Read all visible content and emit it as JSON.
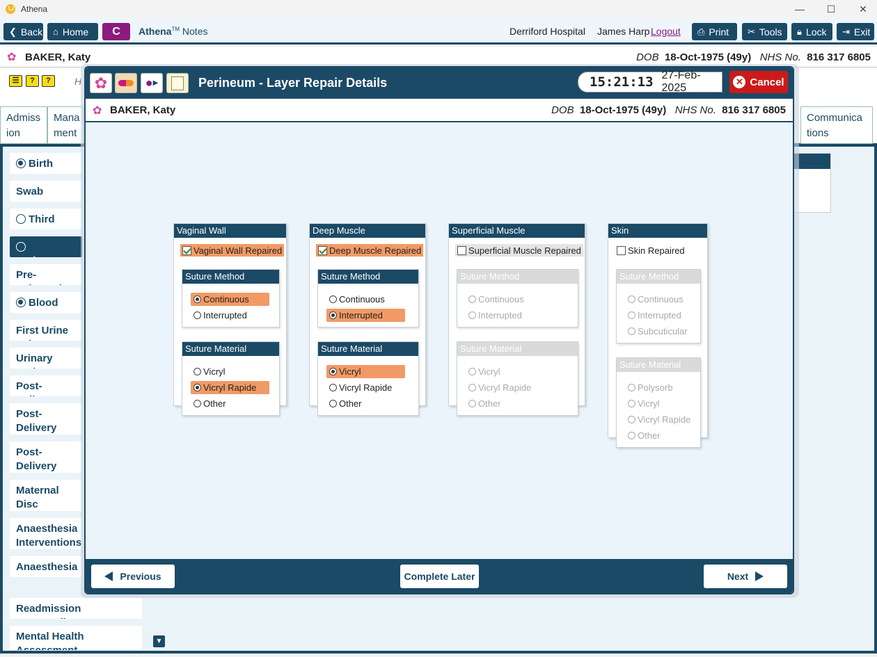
{
  "window": {
    "title": "Athena",
    "minimize": "—",
    "maximize": "☐",
    "close": "✕"
  },
  "toolbar": {
    "back": "Back",
    "home": "Home",
    "c_button": "C",
    "brand": "Athena",
    "brand_tm": "TM",
    "brand_suffix": "Notes",
    "hospital": "Derriford Hospital",
    "user": "James Harp",
    "logout": "Logout",
    "print": "Print",
    "tools": "Tools",
    "lock": "Lock",
    "exit": "Exit"
  },
  "patient": {
    "name": "BAKER, Katy",
    "dob_label": "DOB",
    "dob": "18-Oct-1975 (49y)",
    "nhs_label": "NHS No.",
    "nhs": "816 317 6805"
  },
  "background": {
    "partial_h": "H",
    "tabs": [
      {
        "label": "Admiss\nion"
      },
      {
        "label": "Mana\nment"
      },
      {
        "label": "Communica\ntions"
      }
    ],
    "sidebar": [
      {
        "label": "Birth",
        "radio": "filled"
      },
      {
        "label": "Swab Count",
        "radio": "none"
      },
      {
        "label": "Third Stage",
        "radio": "empty"
      },
      {
        "label": "Perineum",
        "radio": "empty",
        "active": true
      },
      {
        "label": "Pre-Eclampsia",
        "radio": "none"
      },
      {
        "label": "Blood Loss",
        "radio": "filled"
      },
      {
        "label": "First Urine Voi",
        "radio": "none"
      },
      {
        "label": "Urinary Cathe",
        "radio": "none"
      },
      {
        "label": "Post-Delivery",
        "radio": "none"
      },
      {
        "label": "Post-Delivery Notes",
        "radio": "none"
      },
      {
        "label": "Post-Delivery Assessments",
        "radio": "none"
      },
      {
        "label": "Maternal Disc Summary",
        "radio": "none"
      },
      {
        "label": "Anaesthesia Interventions",
        "radio": "none"
      },
      {
        "label": "Anaesthesia F",
        "radio": "none"
      },
      {
        "label": "Readmission Postnatally",
        "radio": "none"
      },
      {
        "label": "Mental Health Assessment",
        "radio": "none"
      }
    ]
  },
  "modal": {
    "title": "Perineum - Layer Repair Details",
    "time": "15:21:13",
    "date": "27-Feb-2025",
    "cancel": "Cancel",
    "patient": {
      "name": "BAKER, Katy",
      "dob_label": "DOB",
      "dob": "18-Oct-1975 (49y)",
      "nhs_label": "NHS No.",
      "nhs": "816 317 6805"
    },
    "panels": [
      {
        "title": "Vaginal Wall",
        "repaired_label": "Vaginal Wall Repaired",
        "repaired": true,
        "method_title": "Suture Method",
        "methods": [
          {
            "label": "Continuous",
            "selected": true
          },
          {
            "label": "Interrupted",
            "selected": false
          }
        ],
        "material_title": "Suture Material",
        "materials": [
          {
            "label": "Vicryl",
            "selected": false
          },
          {
            "label": "Vicryl Rapide",
            "selected": true
          },
          {
            "label": "Other",
            "selected": false
          }
        ]
      },
      {
        "title": "Deep Muscle",
        "repaired_label": "Deep Muscle Repaired",
        "repaired": true,
        "method_title": "Suture Method",
        "methods": [
          {
            "label": "Continuous",
            "selected": false
          },
          {
            "label": "Interrupted",
            "selected": true
          }
        ],
        "material_title": "Suture Material",
        "materials": [
          {
            "label": "Vicryl",
            "selected": true
          },
          {
            "label": "Vicryl Rapide",
            "selected": false
          },
          {
            "label": "Other",
            "selected": false
          }
        ]
      },
      {
        "title": "Superficial Muscle",
        "repaired_label": "Superficial Muscle Repaired",
        "repaired": false,
        "method_title": "Suture Method",
        "methods": [
          {
            "label": "Continuous",
            "selected": false
          },
          {
            "label": "Interrupted",
            "selected": false
          }
        ],
        "material_title": "Suture Material",
        "materials": [
          {
            "label": "Vicryl",
            "selected": false
          },
          {
            "label": "Vicryl Rapide",
            "selected": false
          },
          {
            "label": "Other",
            "selected": false
          }
        ]
      },
      {
        "title": "Skin",
        "repaired_label": "Skin Repaired",
        "repaired": false,
        "method_title": "Suture Method",
        "methods": [
          {
            "label": "Continuous",
            "selected": false
          },
          {
            "label": "Interrupted",
            "selected": false
          },
          {
            "label": "Subcuticular",
            "selected": false
          }
        ],
        "material_title": "Suture Material",
        "materials": [
          {
            "label": "Polysorb",
            "selected": false
          },
          {
            "label": "Vicryl",
            "selected": false
          },
          {
            "label": "Vicryl Rapide",
            "selected": false
          },
          {
            "label": "Other",
            "selected": false
          }
        ]
      }
    ],
    "footer": {
      "previous": "Previous",
      "complete_later": "Complete Later",
      "next": "Next"
    }
  },
  "colors": {
    "primary": "#1b4a66",
    "selected": "#f29a66",
    "cancel": "#cc1a1a",
    "c_button": "#8b1b7f"
  }
}
